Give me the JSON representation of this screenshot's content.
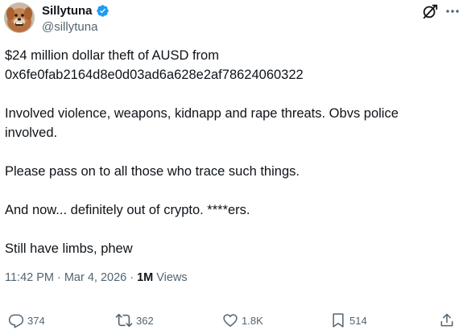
{
  "author": {
    "display_name": "Sillytuna",
    "handle": "@sillytuna",
    "verified_color": "#1d9bf0"
  },
  "icons": {
    "verified": "verified-badge-icon",
    "grok": "grok-icon",
    "more": "more-icon",
    "reply": "reply-icon",
    "retweet": "retweet-icon",
    "like": "heart-icon",
    "bookmark": "bookmark-icon",
    "share": "share-icon"
  },
  "tweet": {
    "paragraphs": [
      "$24 million dollar theft of AUSD from\n0x6fe0fab2164d8e0d03ad6a628e2af78624060322",
      "Involved violence, weapons, kidnapp and rape threats. Obvs police\ninvolved.",
      "Please pass on to all those who trace such things.",
      "And now... definitely out of crypto. ****ers.",
      "Still have limbs, phew"
    ]
  },
  "meta": {
    "time": "11:42 PM",
    "separator1": "·",
    "date": "Mar 4, 2026",
    "separator2": "·",
    "views_count": "1M",
    "views_label": "Views"
  },
  "actions": {
    "replies": "374",
    "retweets": "362",
    "likes": "1.8K",
    "bookmarks": "514"
  },
  "colors": {
    "text": "#0f1419",
    "secondary": "#536471",
    "accent": "#1d9bf0"
  }
}
